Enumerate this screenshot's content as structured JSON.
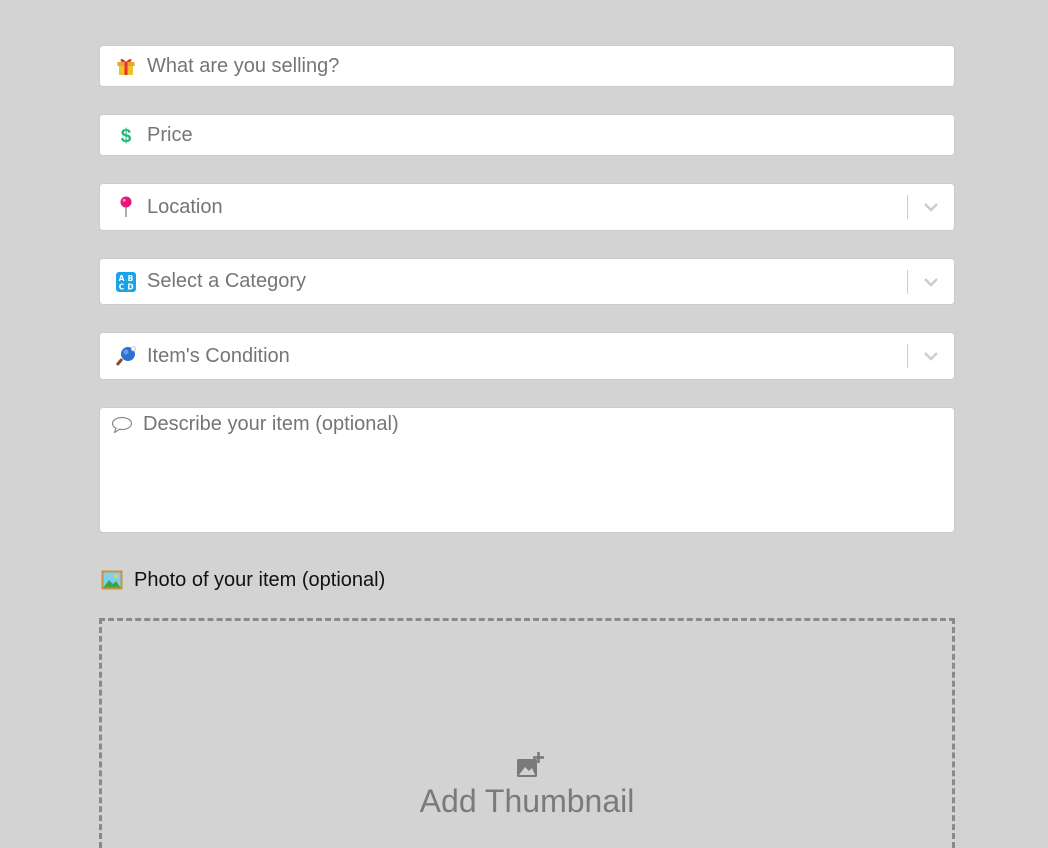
{
  "form": {
    "title_field": {
      "placeholder": "What are you selling?",
      "icon": "gift-icon"
    },
    "price_field": {
      "placeholder": "Price",
      "icon": "dollar-sign-icon"
    },
    "location_select": {
      "placeholder": "Location",
      "icon": "round-pushpin-icon"
    },
    "category_select": {
      "placeholder": "Select a Category",
      "icon": "abcd-input-icon"
    },
    "condition_select": {
      "placeholder": "Item's Condition",
      "icon": "ping-pong-paddle-icon"
    },
    "description_field": {
      "placeholder": "Describe your item (optional)",
      "icon": "speech-balloon-icon"
    },
    "photo_section": {
      "label": "Photo of your item (optional)",
      "icon": "framed-picture-icon",
      "dropzone_label": "Add Thumbnail",
      "dropzone_icon": "add-photo-icon"
    }
  },
  "colors": {
    "page_background": "#d3d3d3",
    "field_background": "#ffffff",
    "placeholder_text": "#757575",
    "price_icon": "#1fb978",
    "pin_icon": "#e8157c",
    "category_icon": "#1aa3e8",
    "dropzone_border": "#8a8a8a"
  }
}
